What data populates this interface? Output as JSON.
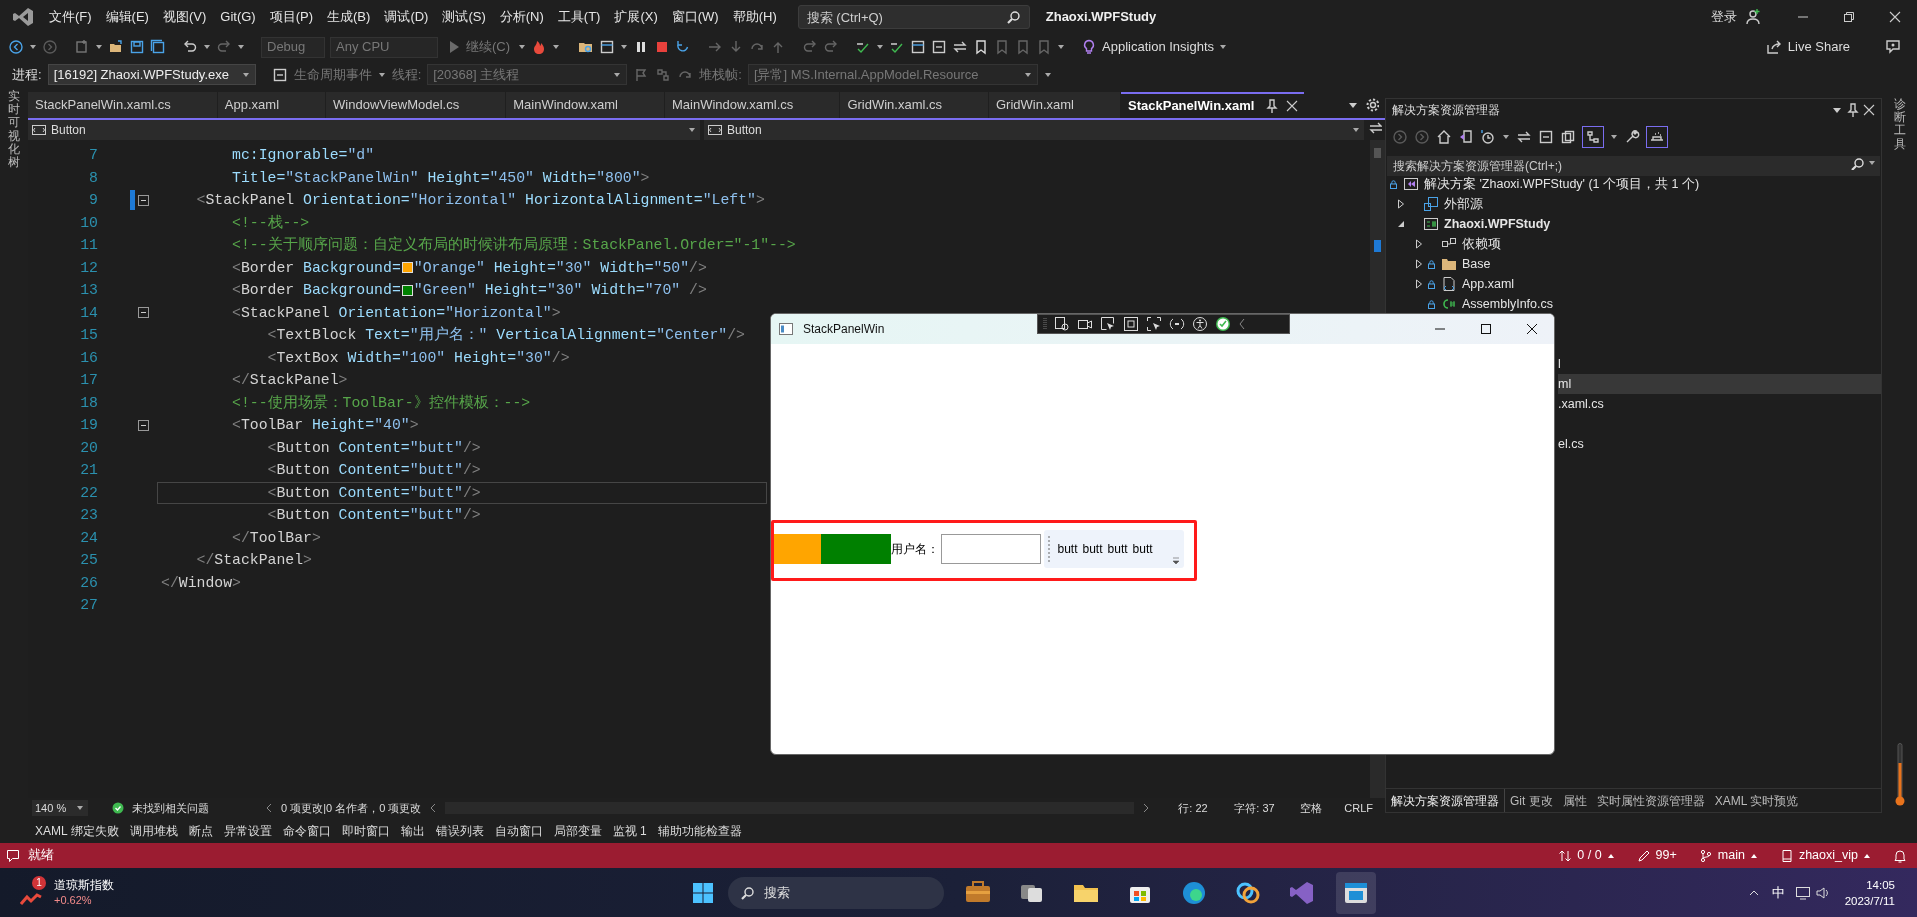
{
  "title_bar": {
    "menus": [
      "文件(F)",
      "编辑(E)",
      "视图(V)",
      "Git(G)",
      "项目(P)",
      "生成(B)",
      "调试(D)",
      "测试(S)",
      "分析(N)",
      "工具(T)",
      "扩展(X)",
      "窗口(W)",
      "帮助(H)"
    ],
    "search": {
      "placeholder": "搜索 (Ctrl+Q)"
    },
    "solution_name": "Zhaoxi.WPFStudy",
    "sign_in": "登录"
  },
  "toolbar": {
    "configuration": {
      "value": "Debug",
      "disabled": true
    },
    "platform": {
      "value": "Any CPU",
      "disabled": true
    },
    "continue": "继续(C)",
    "insights": "Application Insights",
    "live_share": "Live Share"
  },
  "debug_location": {
    "process_label": "进程:",
    "process": "[16192] Zhaoxi.WPFStudy.exe",
    "lifecycle": "生命周期事件",
    "thread_label": "线程:",
    "thread": "[20368] 主线程",
    "stack_label": "堆栈帧:",
    "stack_frame": "[异常] MS.Internal.AppModel.Resource"
  },
  "left_strip": {
    "label": "实时可视化树"
  },
  "right_strip": {
    "label": "诊断工具"
  },
  "editor": {
    "tabs": [
      {
        "label": "StackPanelWin.xaml.cs",
        "selected": false
      },
      {
        "label": "App.xaml",
        "selected": false
      },
      {
        "label": "WindowViewModel.cs",
        "selected": false
      },
      {
        "label": "MainWindow.xaml",
        "selected": false
      },
      {
        "label": "MainWindow.xaml.cs",
        "selected": false
      },
      {
        "label": "GridWin.xaml.cs",
        "selected": false
      },
      {
        "label": "GridWin.xaml",
        "selected": false
      },
      {
        "label": "StackPanelWin.xaml",
        "selected": true
      }
    ],
    "nav": {
      "left": "Button",
      "right": "Button"
    },
    "lines": [
      {
        "number": "7",
        "current": false,
        "changed": false,
        "segments": [
          {
            "kind": "attr",
            "text": "        mc:Ignorable="
          },
          {
            "kind": "value",
            "text": "\"d\""
          }
        ]
      },
      {
        "number": "8",
        "current": false,
        "changed": false,
        "segments": [
          {
            "kind": "attr",
            "text": "        Title="
          },
          {
            "kind": "value",
            "text": "\"StackPanelWin\""
          },
          {
            "kind": "attr",
            "text": " Height="
          },
          {
            "kind": "value",
            "text": "\"450\""
          },
          {
            "kind": "attr",
            "text": " Width="
          },
          {
            "kind": "value",
            "text": "\"800\""
          },
          {
            "kind": "tag",
            "text": ">"
          }
        ]
      },
      {
        "number": "9",
        "current": false,
        "changed": true,
        "fold": {
          "expanded": true
        },
        "segments": [
          {
            "kind": "tag",
            "text": "    <"
          },
          {
            "kind": "name",
            "text": "StackPanel"
          },
          {
            "kind": "attr",
            "text": " Orientation="
          },
          {
            "kind": "value",
            "text": "\"Horizontal\""
          },
          {
            "kind": "attr",
            "text": " HorizontalAlignment="
          },
          {
            "kind": "value",
            "text": "\"Left\""
          },
          {
            "kind": "tag",
            "text": ">"
          }
        ]
      },
      {
        "number": "10",
        "current": false,
        "changed": false,
        "segments": [
          {
            "kind": "comment",
            "text": "        <!--栈-->"
          }
        ]
      },
      {
        "number": "11",
        "current": false,
        "changed": false,
        "segments": [
          {
            "kind": "comment",
            "text": "        <!--关于顺序问题：自定义布局的时候讲布局原理：StackPanel.Order=\"-1\"-->"
          }
        ]
      },
      {
        "number": "12",
        "current": false,
        "changed": false,
        "segments": [
          {
            "kind": "tag",
            "text": "        <"
          },
          {
            "kind": "name",
            "text": "Border"
          },
          {
            "kind": "attr",
            "text": " Background="
          },
          {
            "kind": "swatch",
            "color": "#ffa500"
          },
          {
            "kind": "value",
            "text": "\"Orange\""
          },
          {
            "kind": "attr",
            "text": " Height="
          },
          {
            "kind": "value",
            "text": "\"30\""
          },
          {
            "kind": "attr",
            "text": " Width="
          },
          {
            "kind": "value",
            "text": "\"50\""
          },
          {
            "kind": "tag",
            "text": "/>"
          }
        ]
      },
      {
        "number": "13",
        "current": false,
        "changed": false,
        "segments": [
          {
            "kind": "tag",
            "text": "        <"
          },
          {
            "kind": "name",
            "text": "Border"
          },
          {
            "kind": "attr",
            "text": " Background="
          },
          {
            "kind": "swatch",
            "color": "#008000"
          },
          {
            "kind": "value",
            "text": "\"Green\""
          },
          {
            "kind": "attr",
            "text": " Height="
          },
          {
            "kind": "value",
            "text": "\"30\""
          },
          {
            "kind": "attr",
            "text": " Width="
          },
          {
            "kind": "value",
            "text": "\"70\""
          },
          {
            "kind": "tag",
            "text": " />"
          }
        ]
      },
      {
        "number": "14",
        "current": false,
        "changed": false,
        "fold": {
          "expanded": true
        },
        "segments": [
          {
            "kind": "tag",
            "text": "        <"
          },
          {
            "kind": "name",
            "text": "StackPanel"
          },
          {
            "kind": "attr",
            "text": " Orientation="
          },
          {
            "kind": "value",
            "text": "\"Horizontal\""
          },
          {
            "kind": "tag",
            "text": ">"
          }
        ]
      },
      {
        "number": "15",
        "current": false,
        "changed": false,
        "segments": [
          {
            "kind": "tag",
            "text": "            <"
          },
          {
            "kind": "name",
            "text": "TextBlock"
          },
          {
            "kind": "attr",
            "text": " Text="
          },
          {
            "kind": "value",
            "text": "\"用户名：\""
          },
          {
            "kind": "attr",
            "text": " VerticalAlignment="
          },
          {
            "kind": "value",
            "text": "\"Center\""
          },
          {
            "kind": "tag",
            "text": "/>"
          }
        ]
      },
      {
        "number": "16",
        "current": false,
        "changed": false,
        "segments": [
          {
            "kind": "tag",
            "text": "            <"
          },
          {
            "kind": "name",
            "text": "TextBox"
          },
          {
            "kind": "attr",
            "text": " Width="
          },
          {
            "kind": "value",
            "text": "\"100\""
          },
          {
            "kind": "attr",
            "text": " Height="
          },
          {
            "kind": "value",
            "text": "\"30\""
          },
          {
            "kind": "tag",
            "text": "/>"
          }
        ]
      },
      {
        "number": "17",
        "current": false,
        "changed": false,
        "segments": [
          {
            "kind": "tag",
            "text": "        </"
          },
          {
            "kind": "name",
            "text": "StackPanel"
          },
          {
            "kind": "tag",
            "text": ">"
          }
        ]
      },
      {
        "number": "18",
        "current": false,
        "changed": false,
        "segments": [
          {
            "kind": "comment",
            "text": "        <!--使用场景：ToolBar-》控件模板：-->"
          }
        ]
      },
      {
        "number": "19",
        "current": false,
        "changed": false,
        "fold": {
          "expanded": true
        },
        "segments": [
          {
            "kind": "tag",
            "text": "        <"
          },
          {
            "kind": "name",
            "text": "ToolBar"
          },
          {
            "kind": "attr",
            "text": " Height="
          },
          {
            "kind": "value",
            "text": "\"40\""
          },
          {
            "kind": "tag",
            "text": ">"
          }
        ]
      },
      {
        "number": "20",
        "current": false,
        "changed": false,
        "segments": [
          {
            "kind": "tag",
            "text": "            <"
          },
          {
            "kind": "name",
            "text": "Button"
          },
          {
            "kind": "attr",
            "text": " Content="
          },
          {
            "kind": "value",
            "text": "\"butt\""
          },
          {
            "kind": "tag",
            "text": "/>"
          }
        ]
      },
      {
        "number": "21",
        "current": false,
        "changed": false,
        "segments": [
          {
            "kind": "tag",
            "text": "            <"
          },
          {
            "kind": "name",
            "text": "Button"
          },
          {
            "kind": "attr",
            "text": " Content="
          },
          {
            "kind": "value",
            "text": "\"butt\""
          },
          {
            "kind": "tag",
            "text": "/>"
          }
        ]
      },
      {
        "number": "22",
        "current": true,
        "changed": false,
        "segments": [
          {
            "kind": "tag",
            "text": "            <"
          },
          {
            "kind": "name",
            "text": "Button"
          },
          {
            "kind": "attr",
            "text": " Content="
          },
          {
            "kind": "value",
            "text": "\"butt\""
          },
          {
            "kind": "tag",
            "text": "/>"
          }
        ]
      },
      {
        "number": "23",
        "current": false,
        "changed": false,
        "segments": [
          {
            "kind": "tag",
            "text": "            <"
          },
          {
            "kind": "name",
            "text": "Button"
          },
          {
            "kind": "attr",
            "text": " Content="
          },
          {
            "kind": "value",
            "text": "\"butt\""
          },
          {
            "kind": "tag",
            "text": "/>"
          }
        ]
      },
      {
        "number": "24",
        "current": false,
        "changed": false,
        "segments": [
          {
            "kind": "tag",
            "text": "        </"
          },
          {
            "kind": "name",
            "text": "ToolBar"
          },
          {
            "kind": "tag",
            "text": ">"
          }
        ]
      },
      {
        "number": "25",
        "current": false,
        "changed": false,
        "segments": [
          {
            "kind": "tag",
            "text": "    </"
          },
          {
            "kind": "name",
            "text": "StackPanel"
          },
          {
            "kind": "tag",
            "text": ">"
          }
        ]
      },
      {
        "number": "26",
        "current": false,
        "changed": false,
        "segments": [
          {
            "kind": "tag",
            "text": "</"
          },
          {
            "kind": "name",
            "text": "Window"
          },
          {
            "kind": "tag",
            "text": ">"
          }
        ]
      },
      {
        "number": "27",
        "current": false,
        "changed": false
      }
    ],
    "status": {
      "zoom": "140 %",
      "issues": "未找到相关问题",
      "changes": "0 项更改|0 名作者，0 项更改",
      "line": "行: 22",
      "char": "字符: 37",
      "whitespace": "空格",
      "line_ending": "CRLF"
    }
  },
  "tool_tabs": [
    "XAML 绑定失败",
    "调用堆栈",
    "断点",
    "异常设置",
    "命令窗口",
    "即时窗口",
    "输出",
    "错误列表",
    "自动窗口",
    "局部变量",
    "监视 1",
    "辅助功能检查器"
  ],
  "solution_explorer": {
    "title": "解决方案资源管理器",
    "search": {
      "placeholder": "搜索解决方案资源管理器(Ctrl+;)"
    },
    "tree": [
      {
        "label": "解决方案 'Zhaoxi.WPFStudy' (1 个项目，共 1 个)",
        "kind": "solution",
        "locked": true,
        "selected": false,
        "children": [
          {
            "label": "外部源",
            "kind": "external",
            "locked": false,
            "expanded": false,
            "selected": false
          },
          {
            "label": "Zhaoxi.WPFStudy",
            "kind": "project",
            "locked": false,
            "expanded": true,
            "selected": false,
            "children": [
              {
                "label": "依赖项",
                "kind": "deps",
                "locked": false,
                "expanded": false,
                "selected": false
              },
              {
                "label": "Base",
                "kind": "folder",
                "locked": true,
                "expanded": false,
                "selected": false
              },
              {
                "label": "App.xaml",
                "kind": "xaml",
                "locked": true,
                "expanded": false,
                "selected": false
              },
              {
                "label": "AssemblyInfo.cs",
                "kind": "cs",
                "locked": true,
                "selected": false
              },
              {
                "label": "l",
                "kind": "cut",
                "selected": false
              },
              {
                "label": "ml",
                "kind": "cut",
                "selected": true
              },
              {
                "label": ".xaml.cs",
                "kind": "cut",
                "selected": false
              },
              {
                "label": "el.cs",
                "kind": "cut",
                "selected": false
              }
            ]
          }
        ]
      }
    ],
    "tabs": [
      {
        "label": "解决方案资源管理器",
        "selected": true
      },
      {
        "label": "Git 更改",
        "selected": false
      },
      {
        "label": "属性",
        "selected": false
      },
      {
        "label": "实时属性资源管理器",
        "selected": false
      },
      {
        "label": "XAML 实时预览",
        "selected": false
      }
    ]
  },
  "wpf_window": {
    "title": "StackPanelWin",
    "borders": [
      {
        "color": "#ffa500"
      },
      {
        "color": "#008000"
      }
    ],
    "label": "用户名：",
    "toolbar_buttons": [
      "butt",
      "butt",
      "butt",
      "butt"
    ]
  },
  "status_bar": {
    "state": "就绪",
    "sync": "0 / 0",
    "edits": "99+",
    "branch": "main",
    "repo": "zhaoxi_vip"
  },
  "taskbar": {
    "widget": {
      "badge": "1",
      "title": "道琼斯指数",
      "change": "+0.62%"
    },
    "search": {
      "placeholder": "搜索"
    },
    "ime": "中",
    "time": "14:05",
    "date": "2023/7/11"
  }
}
